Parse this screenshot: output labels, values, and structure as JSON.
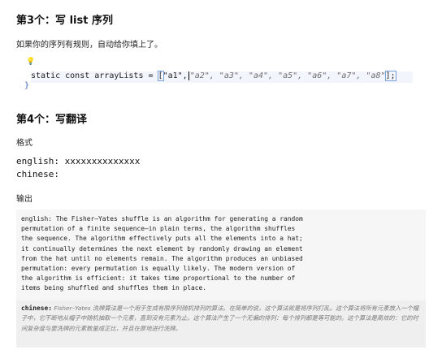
{
  "section3": {
    "title": "第3个：写 list 序列",
    "desc": "如果你的序列有规则，自动给你填上了。",
    "code": {
      "prefix": "static const arrayLists = ",
      "open_bracket": "[",
      "first_item": "\"a1\",",
      "rest_items": "\"a2\", \"a3\", \"a4\", \"a5\", \"a6\", \"a7\", \"a8\"",
      "close": "];",
      "brace": "}"
    }
  },
  "section4": {
    "title": "第4个：写翻译",
    "format_label": "格式",
    "format_lines": [
      "english: xxxxxxxxxxxxxx",
      "chinese:"
    ],
    "output_label": "输出",
    "english_output": "english: The Fisher–Yates shuffle is an algorithm for generating a random\npermutation of a finite sequence—in plain terms, the algorithm shuffles\nthe sequence. The algorithm effectively puts all the elements into a hat;\nit continually determines the next element by randomly drawing an element\nfrom the hat until no elements remain. The algorithm produces an unbiased\npermutation: every permutation is equally likely. The modern version of\nthe algorithm is efficient: it takes time proportional to the number of\nitems being shuffled and shuffles them in place.",
    "chinese_label": "chinese:",
    "chinese_output": "Fisher–Yates 洗牌算法是一个用于生成有限序列随机排列的算法。在简单的说，这个算法就是将序列打乱。这个算法将所有元素放入一个帽子中，它不断地从帽子中随机抽取一个元素，直到没有元素为止。这个算法产生了一个无偏的排列：每个排列都是等可能的。这个算法是高效的：它的时间复杂度与要洗牌的元素数量成正比，并且在原地进行洗牌。"
  },
  "colors": {
    "code_bg": "#f2f5fb",
    "bulb": "#e4a800",
    "brace": "#3a61b0"
  },
  "icons": {
    "bulb": "lightbulb-icon"
  }
}
